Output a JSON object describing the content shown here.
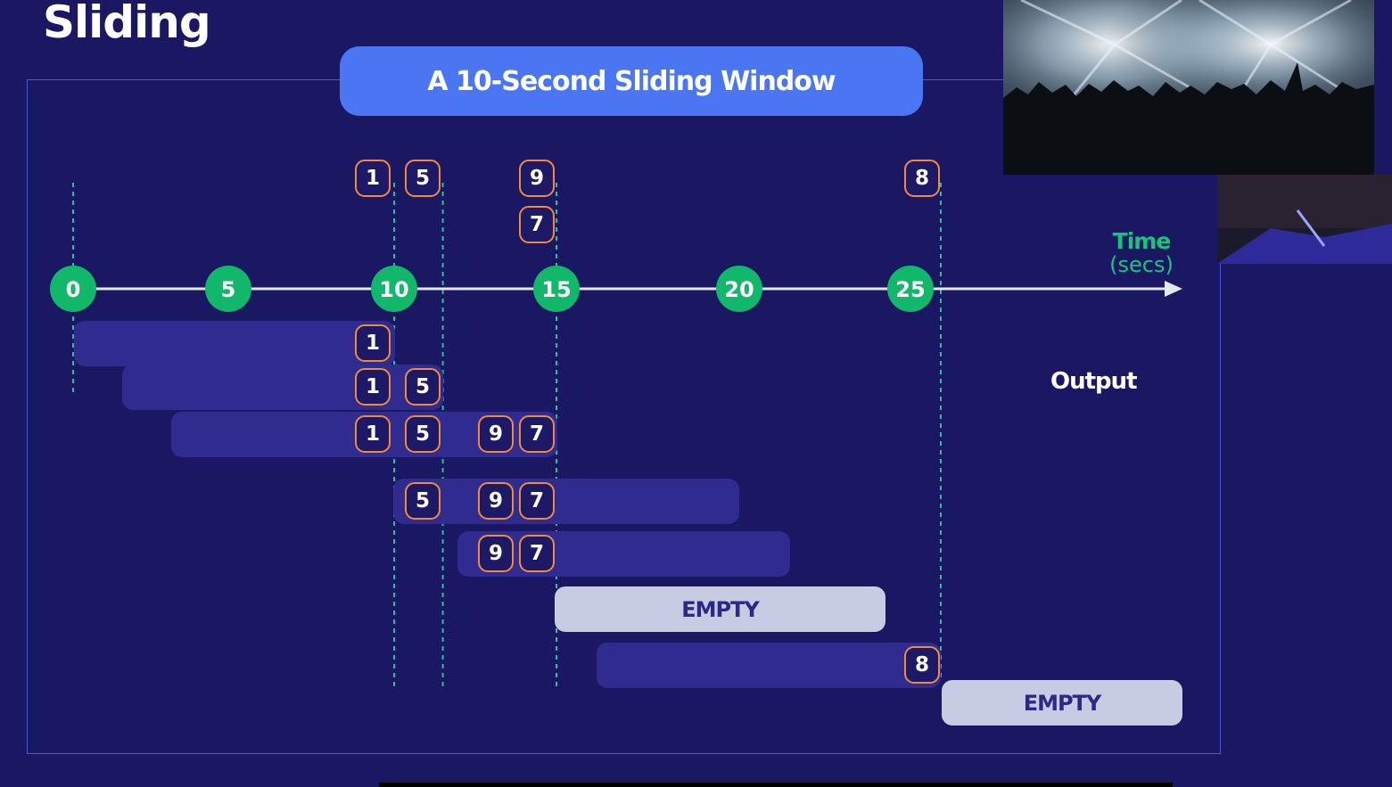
{
  "slide_title": "Sliding",
  "header": "A 10-Second Sliding Window",
  "axis": {
    "label_line1": "Time",
    "label_line2": "(secs)",
    "ticks": [
      {
        "value": 0,
        "label": "0"
      },
      {
        "value": 5,
        "label": "5"
      },
      {
        "value": 10,
        "label": "10"
      },
      {
        "value": 15,
        "label": "15"
      },
      {
        "value": 20,
        "label": "20"
      },
      {
        "value": 25,
        "label": "25"
      }
    ]
  },
  "events": [
    {
      "time": 10,
      "value": "1"
    },
    {
      "time": 11.5,
      "value": "5"
    },
    {
      "time": 15,
      "value": "9"
    },
    {
      "time": 15,
      "value": "7"
    },
    {
      "time": 27,
      "value": "8"
    }
  ],
  "output_label": "Output",
  "windows": [
    {
      "start": 0,
      "end": 10,
      "contents": [
        "1"
      ]
    },
    {
      "start": 1.5,
      "end": 11.5,
      "contents": [
        "1",
        "5"
      ]
    },
    {
      "start": 3,
      "end": 15,
      "contents": [
        "1",
        "5",
        "9",
        "7"
      ]
    },
    {
      "start": 10,
      "end": 20,
      "contents": [
        "5",
        "9",
        "7"
      ]
    },
    {
      "start": 12,
      "end": 22,
      "contents": [
        "9",
        "7"
      ]
    },
    {
      "start": 15,
      "end": 25,
      "contents": [],
      "empty_label": "EMPTY"
    },
    {
      "start": 16,
      "end": 27,
      "contents": [
        "8"
      ]
    },
    {
      "start": 27,
      "end": 35,
      "contents": [],
      "empty_label": "EMPTY"
    }
  ],
  "colors": {
    "background": "#1a1763",
    "header_bg": "#4a75f3",
    "tick_circle": "#11b86a",
    "event_border": "#f08a3c",
    "window_bar": "#2f2b8f",
    "empty_bar": "#c7cce2",
    "guide_line": "#1ec98a",
    "time_label": "#19c57c"
  }
}
